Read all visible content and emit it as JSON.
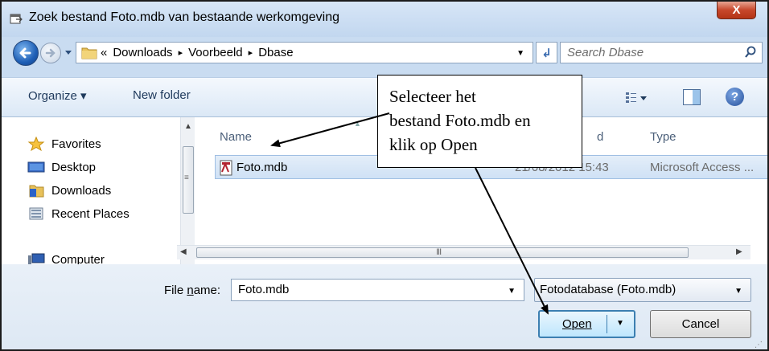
{
  "window": {
    "title": "Zoek bestand Foto.mdb van bestaande werkomgeving",
    "close_label": "X"
  },
  "address": {
    "overflow": "«",
    "crumbs": [
      "Downloads",
      "Voorbeeld",
      "Dbase"
    ],
    "separator": "▸",
    "search_placeholder": "Search Dbase"
  },
  "toolbar": {
    "organize_label": "Organize ▾",
    "new_folder_label": "New folder"
  },
  "nav": {
    "items": [
      {
        "label": "Favorites",
        "icon": "star-icon"
      },
      {
        "label": "Desktop",
        "icon": "desktop-icon"
      },
      {
        "label": "Downloads",
        "icon": "downloads-folder-icon"
      },
      {
        "label": "Recent Places",
        "icon": "recent-places-icon"
      },
      {
        "label": "Computer",
        "icon": "computer-icon"
      }
    ]
  },
  "files": {
    "columns": {
      "name": "Name",
      "date_partial": "d",
      "type": "Type"
    },
    "rows": [
      {
        "name": "Foto.mdb",
        "date": "21/08/2012 15:43",
        "type": "Microsoft Access ..."
      }
    ]
  },
  "bottom": {
    "filename_label_pre": "File ",
    "filename_label_accel": "n",
    "filename_label_post": "ame:",
    "filename_value": "Foto.mdb",
    "filetype_value": "Fotodatabase (Foto.mdb)",
    "open_label": "Open",
    "cancel_label": "Cancel"
  },
  "callout": {
    "lines": [
      "Selecteer het",
      "bestand Foto.mdb en",
      "klik op Open"
    ]
  },
  "colors": {
    "accent": "#3c7fb1",
    "selection": "#cfe1f5",
    "close": "#c7472b"
  }
}
